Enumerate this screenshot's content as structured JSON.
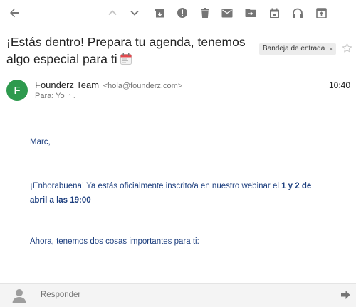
{
  "toolbar": {
    "icons": [
      "back-arrow-icon",
      "chevron-up-icon",
      "chevron-down-icon",
      "archive-icon",
      "spam-icon",
      "delete-icon",
      "mark-unread-icon",
      "move-to-icon",
      "snooze-icon",
      "audio-icon",
      "open-external-icon"
    ]
  },
  "message": {
    "subject": "¡Estás dentro! Prepara tu agenda, tenemos algo especial para ti",
    "label_chip": "Bandeja de entrada",
    "label_chip_remove": "×",
    "sender_name": "Founderz Team",
    "sender_email": "<hola@founderz.com>",
    "avatar_letter": "F",
    "recipient": "Para: Yo",
    "time": "10:40"
  },
  "body": {
    "greeting": "Marc,",
    "para1_start": "¡Enhorabuena! Ya estás oficialmente inscrito/a en nuestro webinar el ",
    "para1_bold": "1 y 2 de abril a las 19:00",
    "para2": "Ahora, tenemos dos cosas importantes para ti:"
  },
  "reply": {
    "placeholder": "Responder"
  },
  "colors": {
    "avatar_bg": "#2e9a4e",
    "body_text": "#1c3e7e",
    "icon_gray": "#757575"
  }
}
